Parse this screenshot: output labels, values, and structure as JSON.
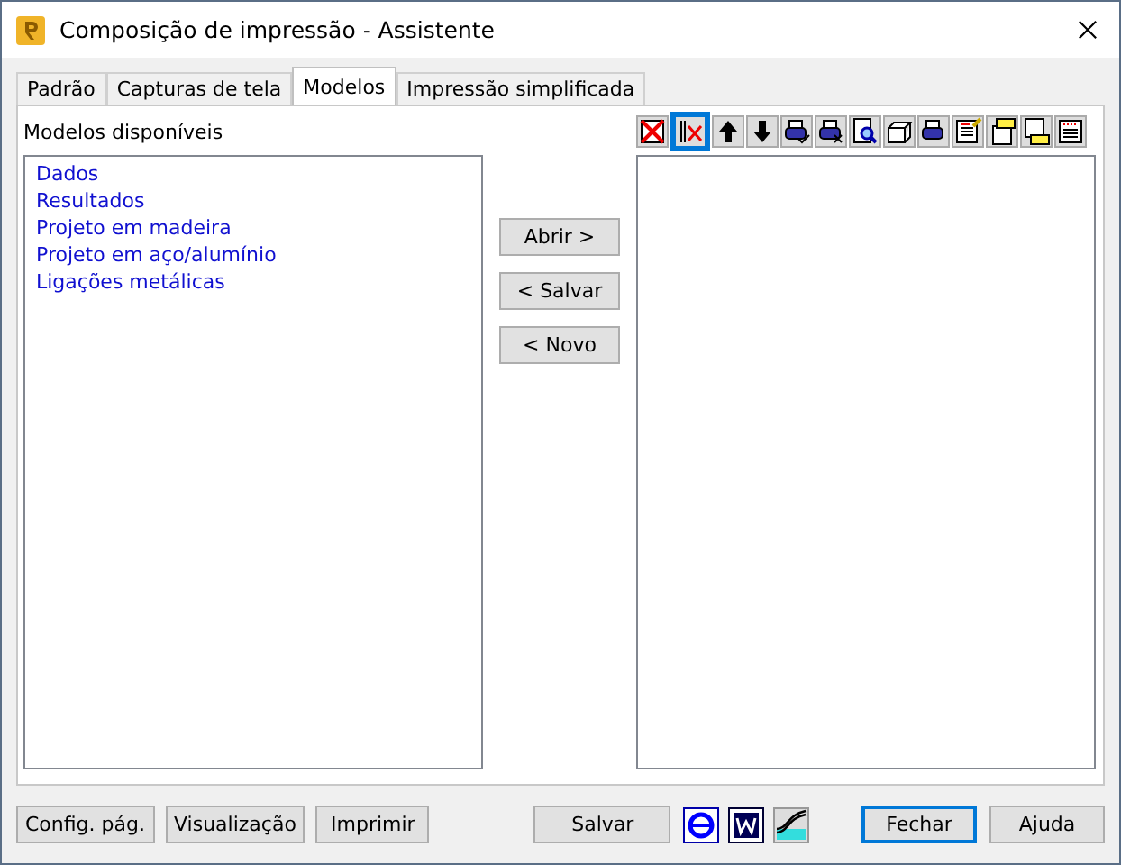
{
  "window": {
    "title": "Composição de impressão - Assistente"
  },
  "tabs": [
    {
      "label": "Padrão",
      "selected": false
    },
    {
      "label": "Capturas de tela",
      "selected": false
    },
    {
      "label": "Modelos",
      "selected": true
    },
    {
      "label": "Impressão simplificada",
      "selected": false
    }
  ],
  "available_models": {
    "label": "Modelos disponíveis",
    "items": [
      "Dados",
      "Resultados",
      "Projeto em madeira",
      "Projeto em aço/alumínio",
      "Ligações metálicas"
    ]
  },
  "middle_buttons": [
    "Abrir >",
    "< Salvar",
    "< Novo"
  ],
  "bottom_left_buttons": [
    {
      "label": "Config. pág.",
      "focused": false
    },
    {
      "label": "Visualização",
      "focused": false
    },
    {
      "label": "Imprimir",
      "focused": false
    }
  ],
  "bottom_center_button": {
    "label": "Salvar",
    "focused": false
  },
  "bottom_right_buttons": [
    {
      "label": "Fechar",
      "focused": true
    },
    {
      "label": "Ajuda",
      "focused": false
    }
  ]
}
